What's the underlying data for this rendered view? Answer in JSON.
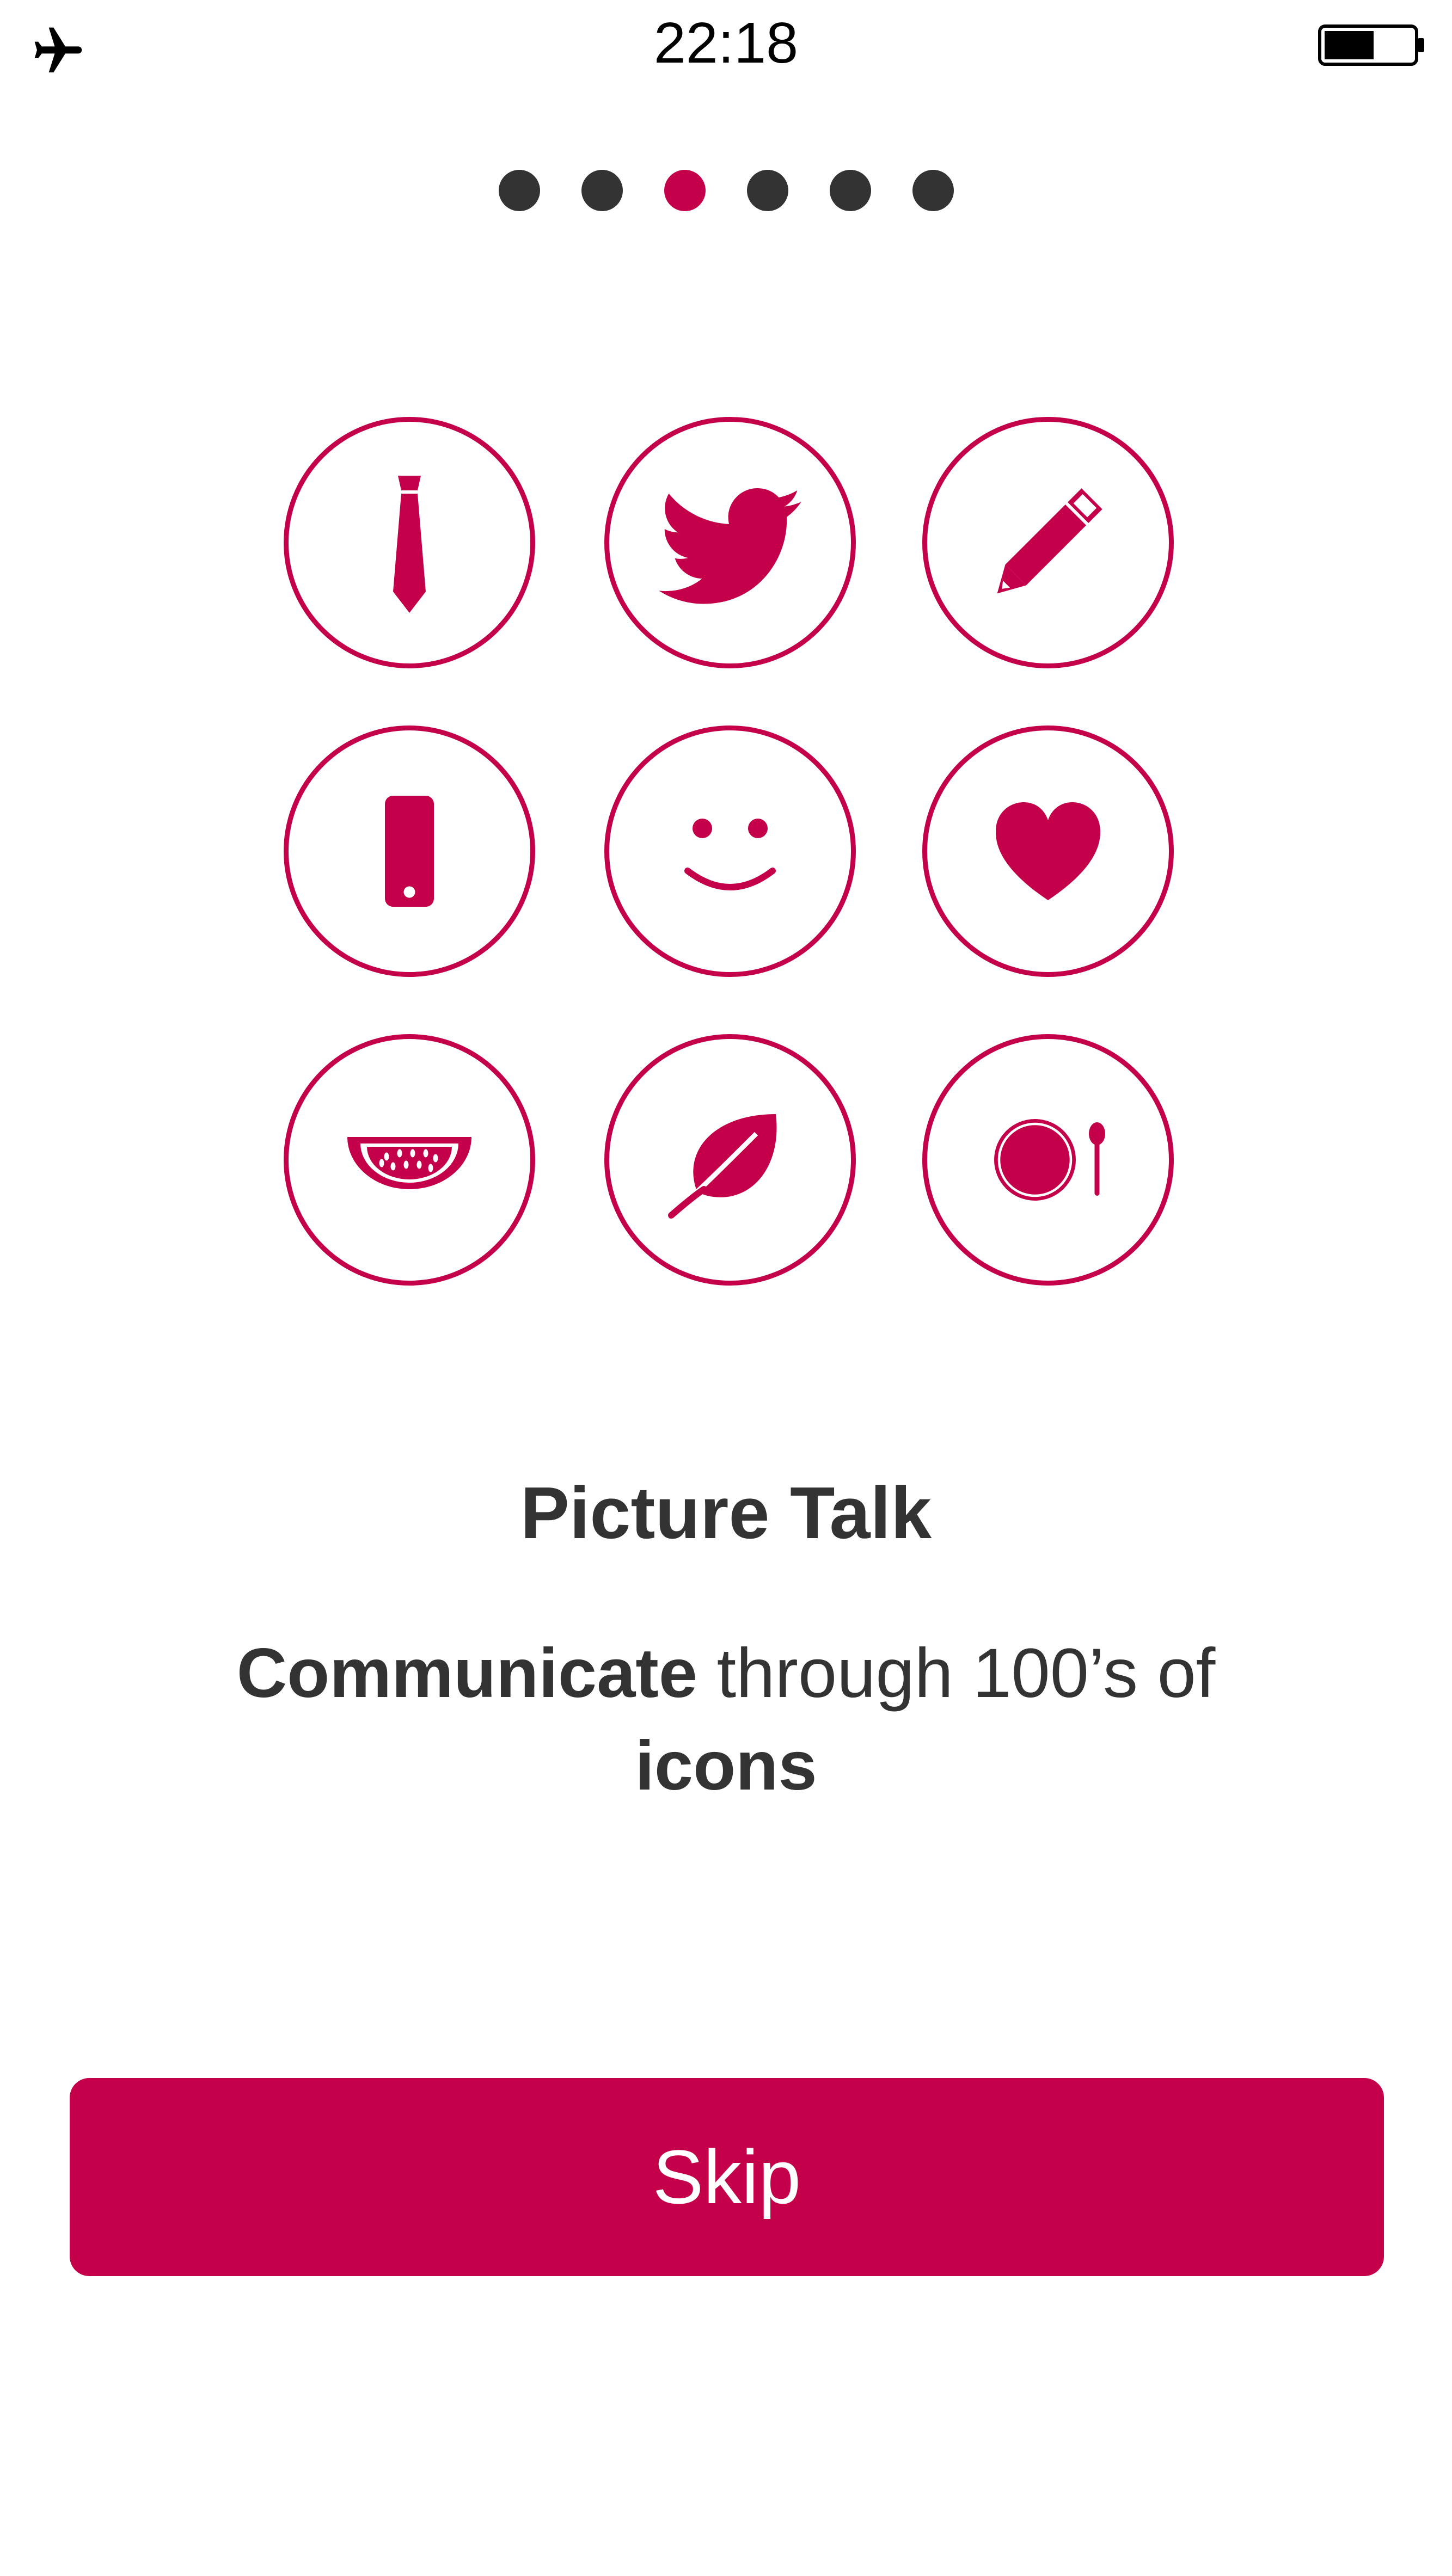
{
  "status_bar": {
    "time": "22:18",
    "airplane_icon": "airplane-icon",
    "battery_icon": "battery-icon",
    "battery_level_fraction": 0.5
  },
  "pager": {
    "total": 6,
    "active_index": 2
  },
  "icons": [
    "tie-icon",
    "bird-icon",
    "pencil-icon",
    "phone-icon",
    "smiley-icon",
    "heart-icon",
    "watermelon-icon",
    "leaf-icon",
    "plate-spoon-icon"
  ],
  "content": {
    "title": "Picture Talk",
    "description": {
      "bold1": "Communicate",
      "text1": " through 100’s of ",
      "bold2": "icons"
    }
  },
  "skip_button": {
    "label": "Skip"
  },
  "colors": {
    "accent": "#c5004a",
    "text": "#333333",
    "dot_inactive": "#333333",
    "background": "#ffffff"
  }
}
